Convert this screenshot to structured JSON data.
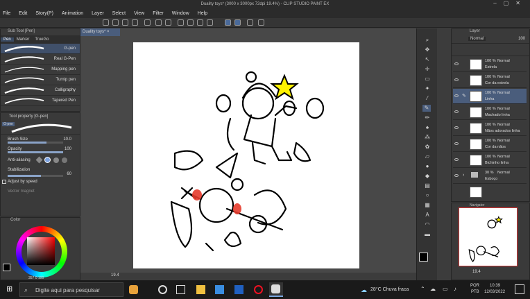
{
  "title": "Duality toys* (3000 x 3000px 72dpi 19.4%) - CLIP STUDIO PAINT EX",
  "menu": [
    "File",
    "Edit",
    "Story(P)",
    "Animation",
    "Layer",
    "Select",
    "View",
    "Filter",
    "Window",
    "Help"
  ],
  "subtool": {
    "header": "Sub Tool [Pen]",
    "tabs": [
      "Pen",
      "Marker",
      "TrueGo"
    ],
    "brushes": [
      "G-pen",
      "Real G-Pen",
      "Mapping pen",
      "Turnip pen",
      "Calligraphy",
      "Tapered Pen"
    ]
  },
  "toolprop": {
    "header": "Tool property [G-pen]",
    "groups": [
      "G-pen"
    ],
    "brush_size_label": "Brush Size",
    "brush_size_value": "10.0",
    "opacity_label": "Opacity",
    "opacity_value": "100",
    "antialias_label": "Anti-aliasing",
    "stabilization_label": "Stabilization",
    "stabilization_value": "60",
    "adjust_label": "Adjust by speed",
    "vector_label": "Vector magnet"
  },
  "color": {
    "header": "Color",
    "readout": "357 0 100"
  },
  "doc_tab": "Duality toys*",
  "canvas_zoom": "19.4",
  "layers": {
    "header": "Layer",
    "blend": "Normal",
    "opacity": "100",
    "items": [
      {
        "pct": "100 %",
        "mode": "Normal",
        "name": "Estrela"
      },
      {
        "pct": "100 %",
        "mode": "Normal",
        "name": "Cor da estrela"
      },
      {
        "pct": "100 %",
        "mode": "Normal",
        "name": "Linha"
      },
      {
        "pct": "100 %",
        "mode": "Normal",
        "name": "Machado linha"
      },
      {
        "pct": "100 %",
        "mode": "Normal",
        "name": "Nãos adorados linha"
      },
      {
        "pct": "100 %",
        "mode": "Normal",
        "name": "Cor da nãos"
      },
      {
        "pct": "100 %",
        "mode": "Normal",
        "name": "Bichinho linha"
      },
      {
        "pct": "30 %",
        "mode": "Normal",
        "name": "Esboço"
      }
    ]
  },
  "navigator": {
    "header": "Navigator",
    "zoom": "19.4"
  },
  "taskbar": {
    "search": "Digite aqui para pesquisar",
    "weather": "28°C Chuva fraca",
    "lang1": "POR",
    "lang2": "PTB",
    "time": "10:39",
    "date": "12/03/2022"
  },
  "colors": {
    "accent": "#4a5d7c",
    "star": "#fff200",
    "red": "#e53b2c"
  }
}
